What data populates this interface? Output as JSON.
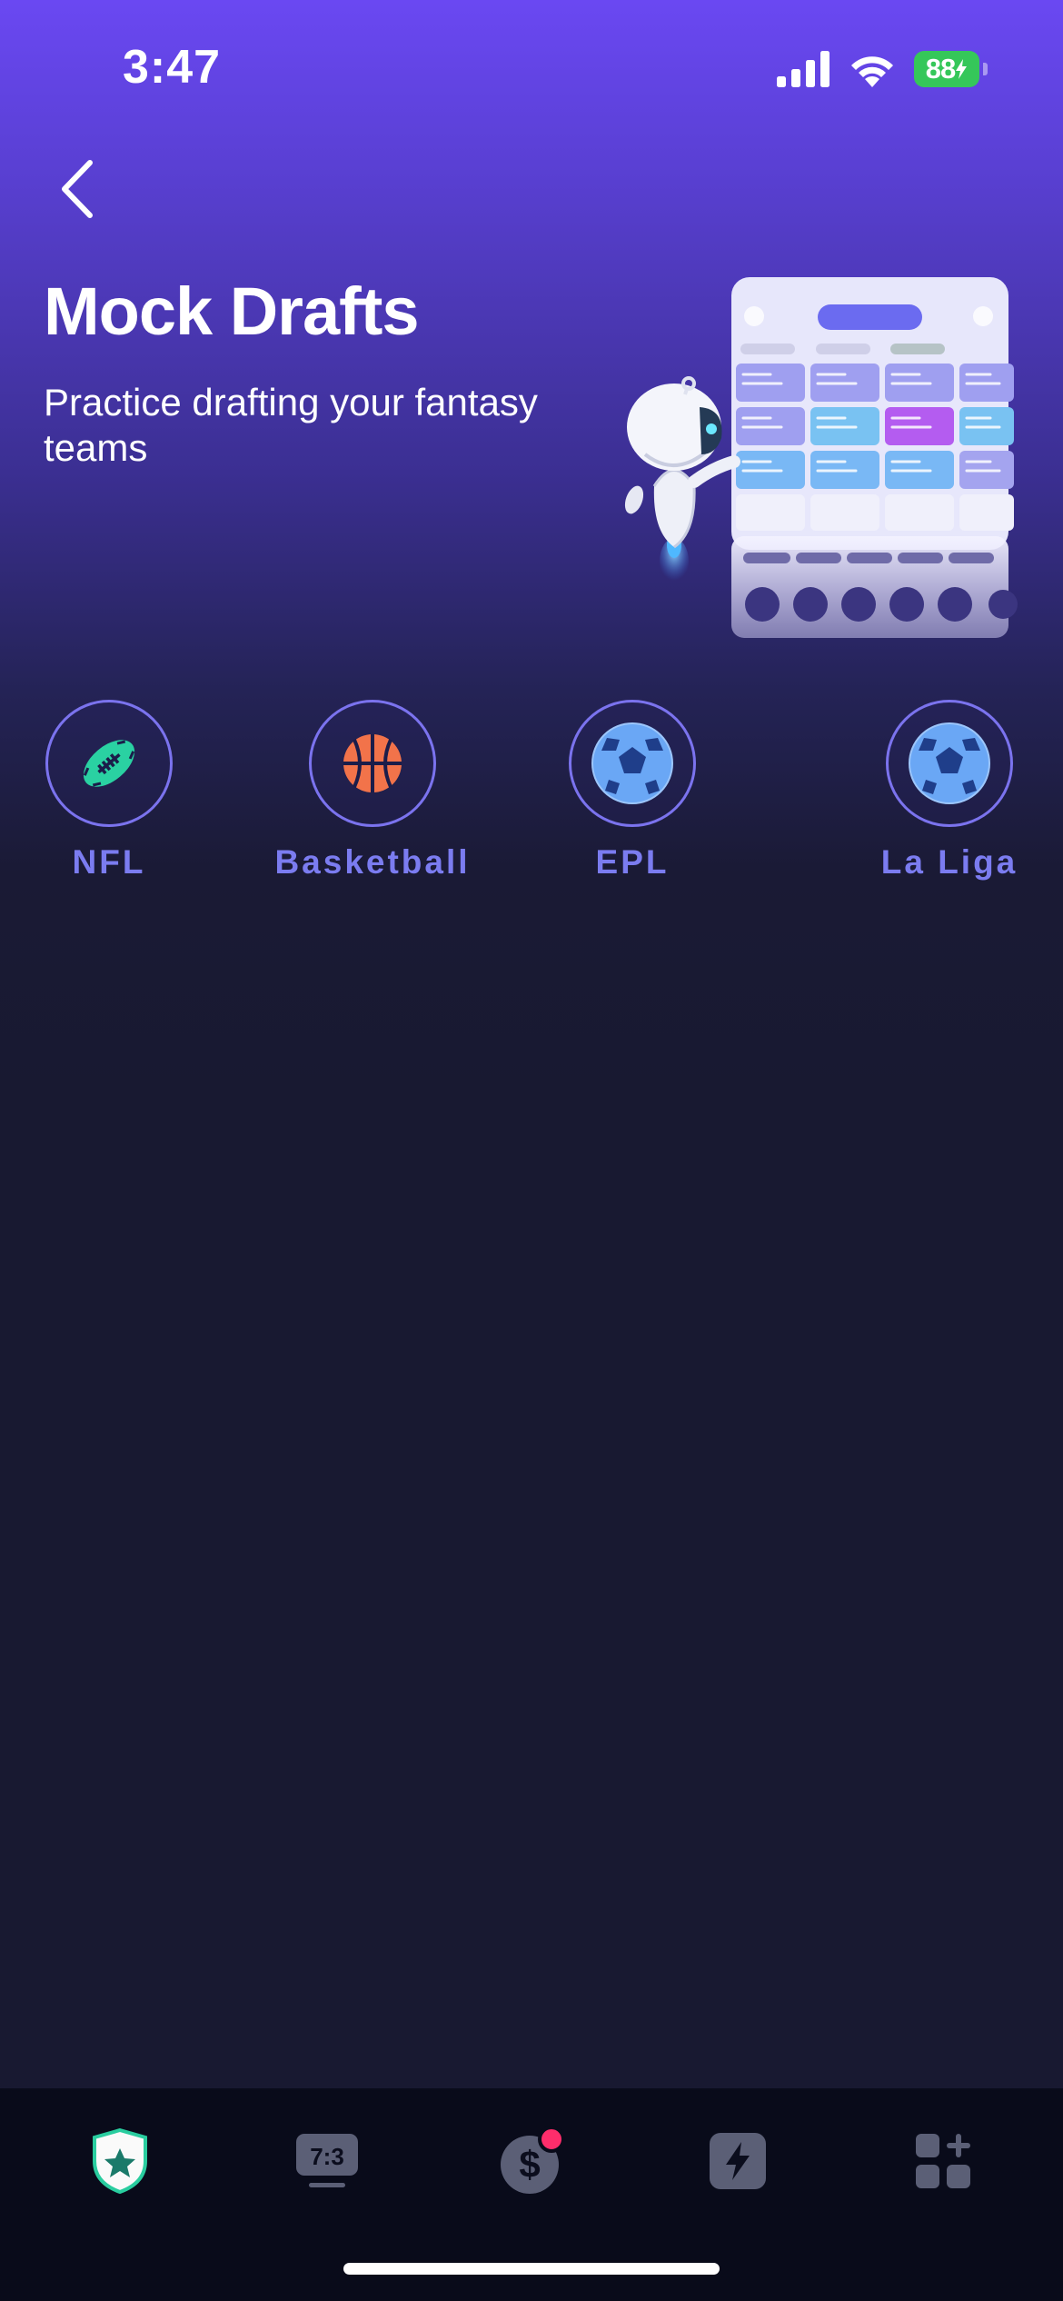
{
  "status_bar": {
    "time": "3:47",
    "battery_level": "88"
  },
  "header": {
    "back_icon": "chevron-left-icon",
    "title": "Mock Drafts",
    "subtitle": "Practice drafting your fantasy teams"
  },
  "sports": [
    {
      "label": "NFL",
      "icon": "football-icon",
      "color": "#2ad1a2"
    },
    {
      "label": "Basketball",
      "icon": "basketball-icon",
      "color": "#f2734a"
    },
    {
      "label": "EPL",
      "icon": "soccer-ball-icon",
      "color": "#6aa7f5"
    },
    {
      "label": "La Liga",
      "icon": "soccer-ball-icon",
      "color": "#6aa7f5"
    }
  ],
  "tab_bar": {
    "tabs": [
      {
        "name": "fantasy-shield",
        "icon": "shield-star-icon",
        "active": true
      },
      {
        "name": "scores",
        "icon": "scoreboard-icon",
        "text": "7:3"
      },
      {
        "name": "money",
        "icon": "dollar-icon",
        "badge": true
      },
      {
        "name": "live",
        "icon": "lightning-icon"
      },
      {
        "name": "more",
        "icon": "apps-grid-icon"
      }
    ]
  },
  "colors": {
    "accent": "#7b7cf0",
    "background": "#181931",
    "header_gradient_top": "#6a48f2",
    "active_tab": "#2ad1a2",
    "badge": "#ff2d6b"
  }
}
